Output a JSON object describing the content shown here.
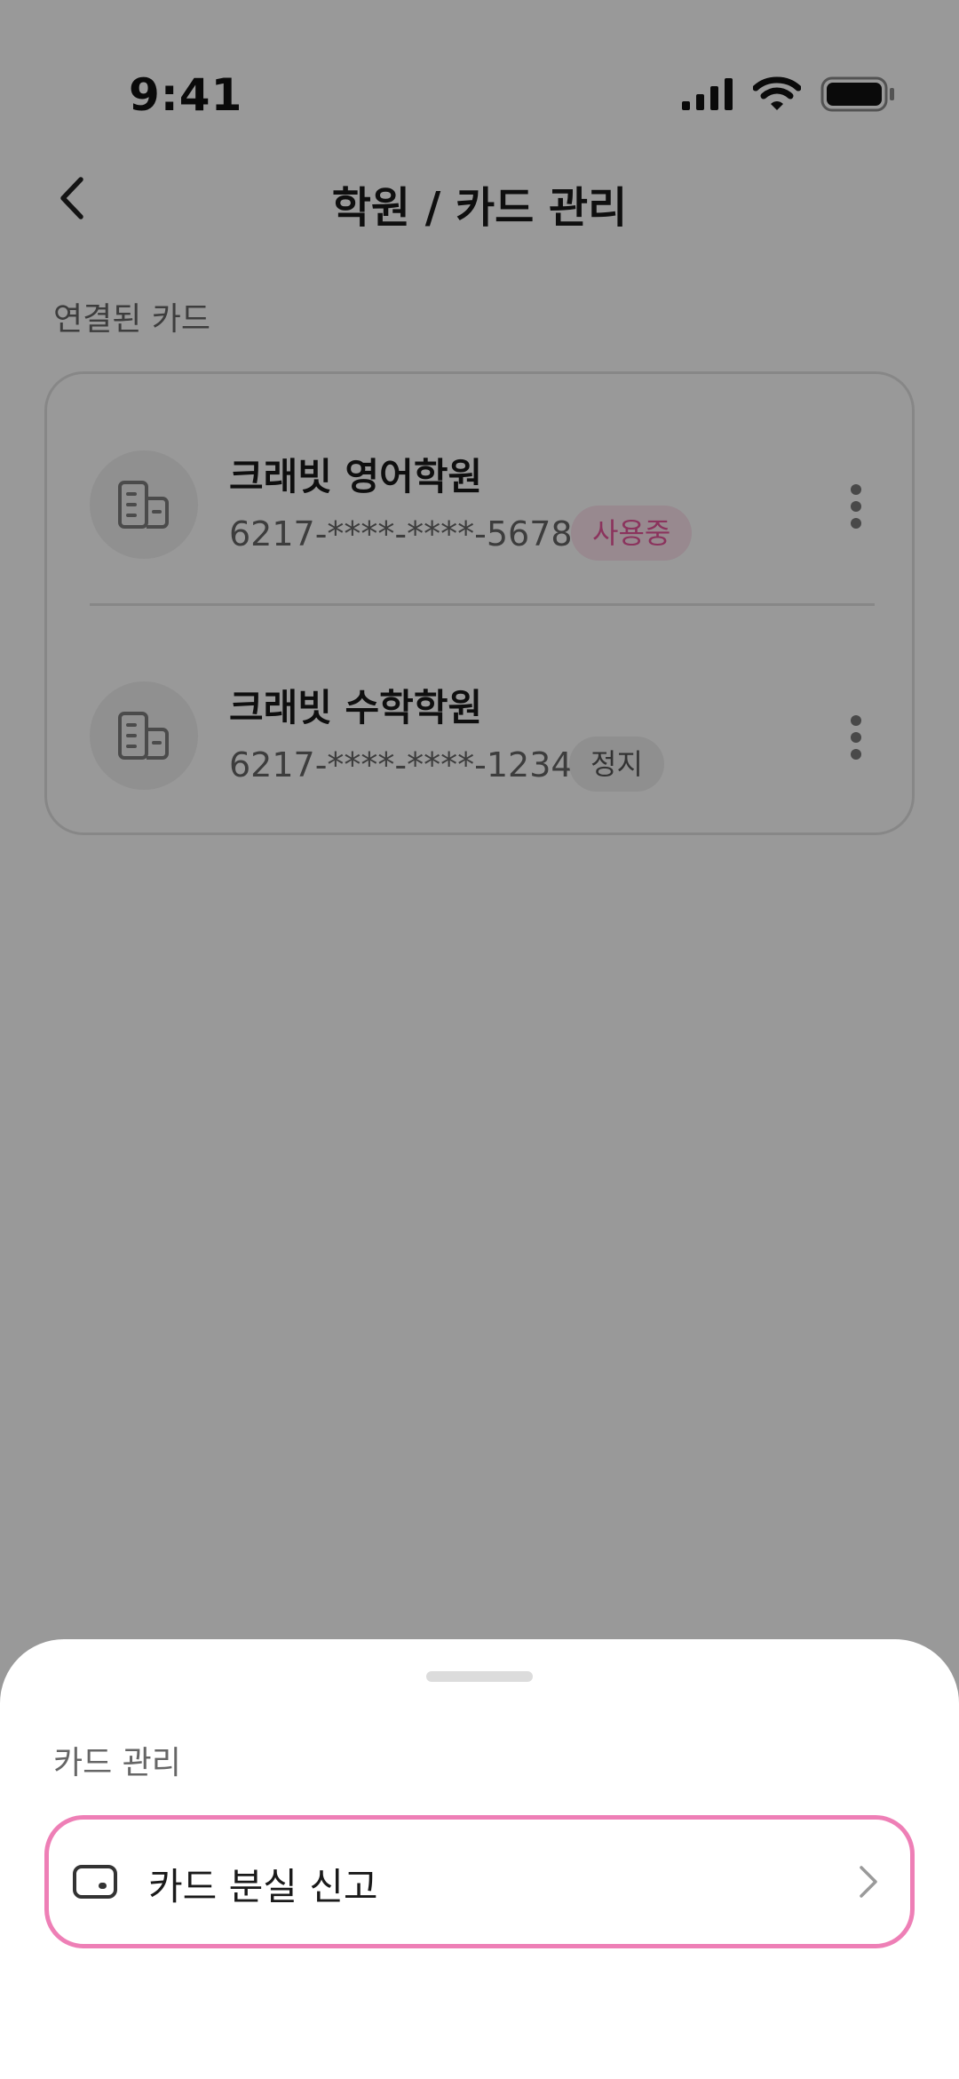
{
  "status_bar": {
    "time": "9:41"
  },
  "header": {
    "back_icon": "chevron-left-icon",
    "title": "학원 / 카드 관리"
  },
  "cards_section": {
    "label": "연결된 카드",
    "items": [
      {
        "academy_name": "크래빗 영어학원",
        "card_number": "6217-****-****-5678",
        "status": "사용중",
        "status_color": "#e8559b",
        "icon": "building-icon"
      },
      {
        "academy_name": "크래빗 수학학원",
        "card_number": "6217-****-****-1234",
        "status": "정지",
        "status_color": "#555555",
        "icon": "building-icon"
      }
    ]
  },
  "bottom_sheet": {
    "label": "카드 관리",
    "action": {
      "label": "카드 분실 신고",
      "icon": "card-icon",
      "trailing_icon": "chevron-right-icon",
      "highlight_color": "#ee7fb6"
    }
  },
  "colors": {
    "accent_pink": "#e8559b",
    "border": "#e2e2e2",
    "text_primary": "#1a1a1a",
    "text_secondary": "#666666"
  }
}
